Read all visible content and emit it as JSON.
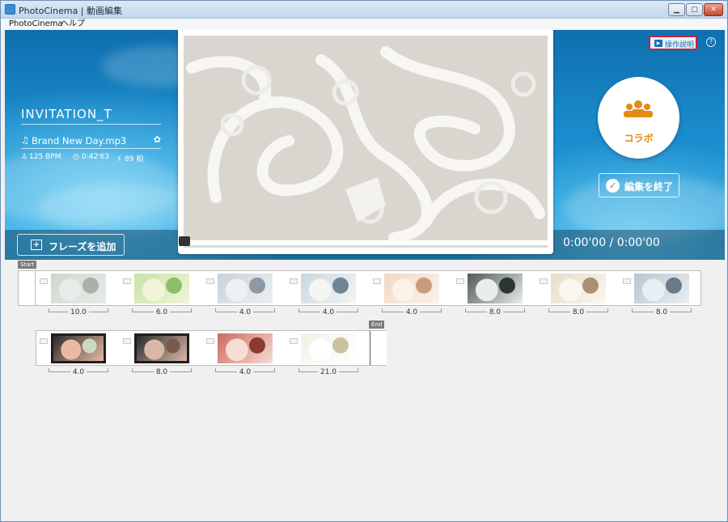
{
  "window": {
    "title": "PhotoCinema | 動画編集",
    "min": "▁",
    "max": "▢",
    "close": "✕"
  },
  "menu": [
    "PhotoCinema",
    "ヘルプ"
  ],
  "project": {
    "title": "INVITATION_T",
    "song": "Brand New Day.mp3",
    "bpm": "125 BPM",
    "duration": "0:42'63",
    "beats": "89 拍"
  },
  "buttons": {
    "add_phrase": "フレーズを追加",
    "help": "操作説明",
    "question": "?",
    "collab": "コラボ",
    "finish": "編集を終了"
  },
  "timecode": "0:00'00 / 0:00'00",
  "timeline": {
    "start_label": "Start",
    "end_label": "End",
    "row1": [
      {
        "duration": "10.0",
        "icon": "photo-lace-thumb"
      },
      {
        "duration": "6.0",
        "icon": "photo-floral-card-thumb"
      },
      {
        "duration": "4.0",
        "icon": "photo-bride-thumb"
      },
      {
        "duration": "4.0",
        "icon": "photo-couple-thumb"
      },
      {
        "duration": "4.0",
        "icon": "photo-interior-thumb"
      },
      {
        "duration": "8.0",
        "icon": "photo-dark-collage-thumb"
      },
      {
        "duration": "8.0",
        "icon": "photo-window-couple-thumb"
      },
      {
        "duration": "8.0",
        "icon": "photo-dress-thumb"
      }
    ],
    "row2": [
      {
        "duration": "4.0",
        "icon": "photo-friends-thumb"
      },
      {
        "duration": "8.0",
        "icon": "photo-couple-frame-thumb"
      },
      {
        "duration": "4.0",
        "icon": "photo-red-thumb"
      },
      {
        "duration": "21.0",
        "icon": "photo-invitation-card-thumb"
      }
    ]
  },
  "colors": {
    "accent_orange": "#e58a12",
    "help_border": "#c8203a",
    "hero_blue": "#1a8ccd"
  }
}
